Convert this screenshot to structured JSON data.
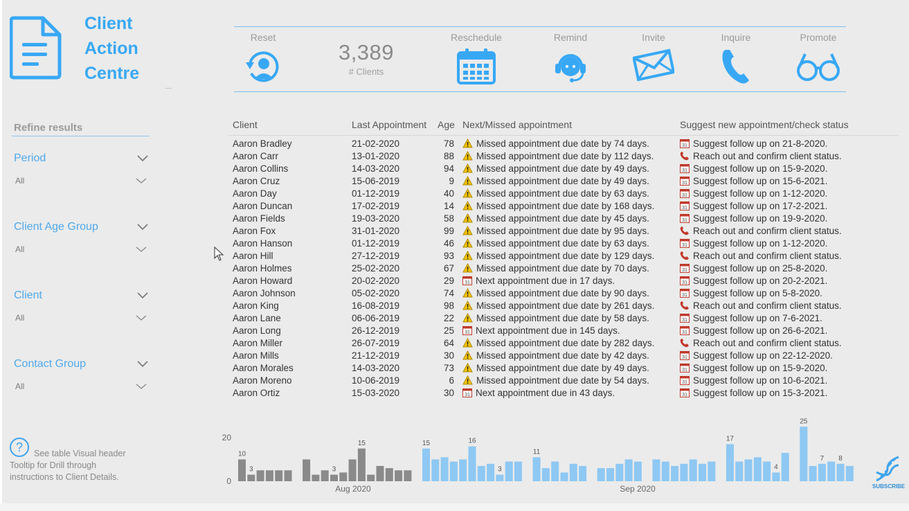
{
  "app": {
    "title_lines": [
      "Client",
      "Action",
      "Centre"
    ]
  },
  "actions": {
    "reset": "Reset",
    "kpi_value": "3,389",
    "kpi_label": "# Clients",
    "reschedule": "Reschedule",
    "remind": "Remind",
    "invite": "Invite",
    "inquire": "Inquire",
    "promote": "Promote"
  },
  "filters": {
    "heading": "Refine results",
    "items": [
      {
        "title": "Period",
        "value": "All"
      },
      {
        "title": "Client Age Group",
        "value": "All"
      },
      {
        "title": "Client",
        "value": "All"
      },
      {
        "title": "Contact Group",
        "value": "All"
      }
    ]
  },
  "table": {
    "columns": [
      "Client",
      "Last Appointment",
      "Age",
      "Next/Missed appointment",
      "Suggest new appointment/check status"
    ],
    "rows": [
      {
        "client": "Aaron Bradley",
        "last": "21-02-2020",
        "age": "78",
        "status_icon": "warning-icon",
        "status": "Missed appointment due date by 74 days.",
        "suggest_icon": "calendar-icon",
        "suggest": "Suggest follow up on 21-8-2020."
      },
      {
        "client": "Aaron Carr",
        "last": "13-01-2020",
        "age": "88",
        "status_icon": "warning-icon",
        "status": "Missed appointment due date by 112 days.",
        "suggest_icon": "phone-icon",
        "suggest": "Reach out and confirm client status."
      },
      {
        "client": "Aaron Collins",
        "last": "14-03-2020",
        "age": "94",
        "status_icon": "warning-icon",
        "status": "Missed appointment due date by 49 days.",
        "suggest_icon": "calendar-icon",
        "suggest": "Suggest follow up on 15-9-2020."
      },
      {
        "client": "Aaron Cruz",
        "last": "15-06-2019",
        "age": "9",
        "status_icon": "warning-icon",
        "status": "Missed appointment due date by 49 days.",
        "suggest_icon": "calendar-icon",
        "suggest": "Suggest follow up on 15-6-2021."
      },
      {
        "client": "Aaron Day",
        "last": "01-12-2019",
        "age": "40",
        "status_icon": "warning-icon",
        "status": "Missed appointment due date by 63 days.",
        "suggest_icon": "calendar-icon",
        "suggest": "Suggest follow up on 1-12-2020."
      },
      {
        "client": "Aaron Duncan",
        "last": "17-02-2019",
        "age": "14",
        "status_icon": "warning-icon",
        "status": "Missed appointment due date by 168 days.",
        "suggest_icon": "calendar-icon",
        "suggest": "Suggest follow up on 17-2-2021."
      },
      {
        "client": "Aaron Fields",
        "last": "19-03-2020",
        "age": "58",
        "status_icon": "warning-icon",
        "status": "Missed appointment due date by 45 days.",
        "suggest_icon": "calendar-icon",
        "suggest": "Suggest follow up on 19-9-2020."
      },
      {
        "client": "Aaron Fox",
        "last": "31-01-2020",
        "age": "99",
        "status_icon": "warning-icon",
        "status": "Missed appointment due date by 95 days.",
        "suggest_icon": "phone-icon",
        "suggest": "Reach out and confirm client status."
      },
      {
        "client": "Aaron Hanson",
        "last": "01-12-2019",
        "age": "46",
        "status_icon": "warning-icon",
        "status": "Missed appointment due date by 63 days.",
        "suggest_icon": "calendar-icon",
        "suggest": "Suggest follow up on 1-12-2020."
      },
      {
        "client": "Aaron Hill",
        "last": "27-12-2019",
        "age": "93",
        "status_icon": "warning-icon",
        "status": "Missed appointment due date by 129 days.",
        "suggest_icon": "phone-icon",
        "suggest": "Reach out and confirm client status."
      },
      {
        "client": "Aaron Holmes",
        "last": "25-02-2020",
        "age": "67",
        "status_icon": "warning-icon",
        "status": "Missed appointment due date by 70 days.",
        "suggest_icon": "calendar-icon",
        "suggest": "Suggest follow up on 25-8-2020."
      },
      {
        "client": "Aaron Howard",
        "last": "20-02-2020",
        "age": "29",
        "status_icon": "calendar-icon",
        "status": "Next appointment due in 17 days.",
        "suggest_icon": "calendar-icon",
        "suggest": "Suggest follow up on 20-2-2021."
      },
      {
        "client": "Aaron Johnson",
        "last": "05-02-2020",
        "age": "74",
        "status_icon": "warning-icon",
        "status": "Missed appointment due date by 90 days.",
        "suggest_icon": "calendar-icon",
        "suggest": "Suggest follow up on 5-8-2020."
      },
      {
        "client": "Aaron King",
        "last": "16-08-2019",
        "age": "98",
        "status_icon": "warning-icon",
        "status": "Missed appointment due date by 261 days.",
        "suggest_icon": "phone-icon",
        "suggest": "Reach out and confirm client status."
      },
      {
        "client": "Aaron Lane",
        "last": "06-06-2019",
        "age": "22",
        "status_icon": "warning-icon",
        "status": "Missed appointment due date by 58 days.",
        "suggest_icon": "calendar-icon",
        "suggest": "Suggest follow up on 7-6-2021."
      },
      {
        "client": "Aaron Long",
        "last": "26-12-2019",
        "age": "25",
        "status_icon": "calendar-icon",
        "status": "Next appointment due in 145 days.",
        "suggest_icon": "calendar-icon",
        "suggest": "Suggest follow up on 26-6-2021."
      },
      {
        "client": "Aaron Miller",
        "last": "26-07-2019",
        "age": "64",
        "status_icon": "warning-icon",
        "status": "Missed appointment due date by 282 days.",
        "suggest_icon": "phone-icon",
        "suggest": "Reach out and confirm client status."
      },
      {
        "client": "Aaron Mills",
        "last": "21-12-2019",
        "age": "30",
        "status_icon": "warning-icon",
        "status": "Missed appointment due date by 42 days.",
        "suggest_icon": "calendar-icon",
        "suggest": "Suggest follow up on 22-12-2020."
      },
      {
        "client": "Aaron Morales",
        "last": "14-03-2020",
        "age": "73",
        "status_icon": "warning-icon",
        "status": "Missed appointment due date by 49 days.",
        "suggest_icon": "calendar-icon",
        "suggest": "Suggest follow up on 15-9-2020."
      },
      {
        "client": "Aaron Moreno",
        "last": "10-06-2019",
        "age": "6",
        "status_icon": "warning-icon",
        "status": "Missed appointment due date by 54 days.",
        "suggest_icon": "calendar-icon",
        "suggest": "Suggest follow up on 10-6-2021."
      },
      {
        "client": "Aaron Ortiz",
        "last": "15-03-2020",
        "age": "30",
        "status_icon": "calendar-icon",
        "status": "Next appointment due in 43 days.",
        "suggest_icon": "calendar-icon",
        "suggest": "Suggest follow up on 15-3-2021."
      }
    ]
  },
  "help": {
    "line1": "See table Visual header",
    "line2": "Tooltip for Drill through",
    "line3": "instructions to Client Details."
  },
  "subscribe_label": "SUBSCRIBE",
  "chart_data": {
    "type": "bar",
    "yticks": [
      "20",
      "0"
    ],
    "ylim": [
      0,
      20
    ],
    "xtick_labels": [
      "Aug 2020",
      "Sep 2020"
    ],
    "values": [
      10,
      3,
      5,
      5,
      5,
      5,
      0,
      10,
      3,
      5,
      3,
      4,
      10,
      15,
      3,
      7,
      6,
      5,
      5,
      0,
      15,
      10,
      11,
      9,
      10,
      16,
      7,
      8,
      3,
      9,
      9,
      0,
      11,
      6,
      9,
      4,
      8,
      7,
      0,
      6,
      6,
      8,
      10,
      9,
      0,
      10,
      9,
      7,
      8,
      10,
      8,
      9,
      0,
      17,
      9,
      10,
      11,
      9,
      4,
      13,
      0,
      25,
      7,
      8,
      9,
      8,
      7
    ],
    "bar_colors": {
      "past": "#8a8a8a",
      "future": "#8ec8f3"
    },
    "past_count": 19,
    "labels": {
      "0": "10",
      "1": "3",
      "10": "3",
      "13": "15",
      "20": "15",
      "25": "16",
      "28": "3",
      "32": "11",
      "53": "17",
      "58": "4",
      "61": "25",
      "63": "7",
      "65": "8"
    }
  },
  "colors": {
    "accent": "#3da4ee",
    "warning": "#f5c400",
    "phone": "#c0392b",
    "calendar": "#c0392b"
  }
}
